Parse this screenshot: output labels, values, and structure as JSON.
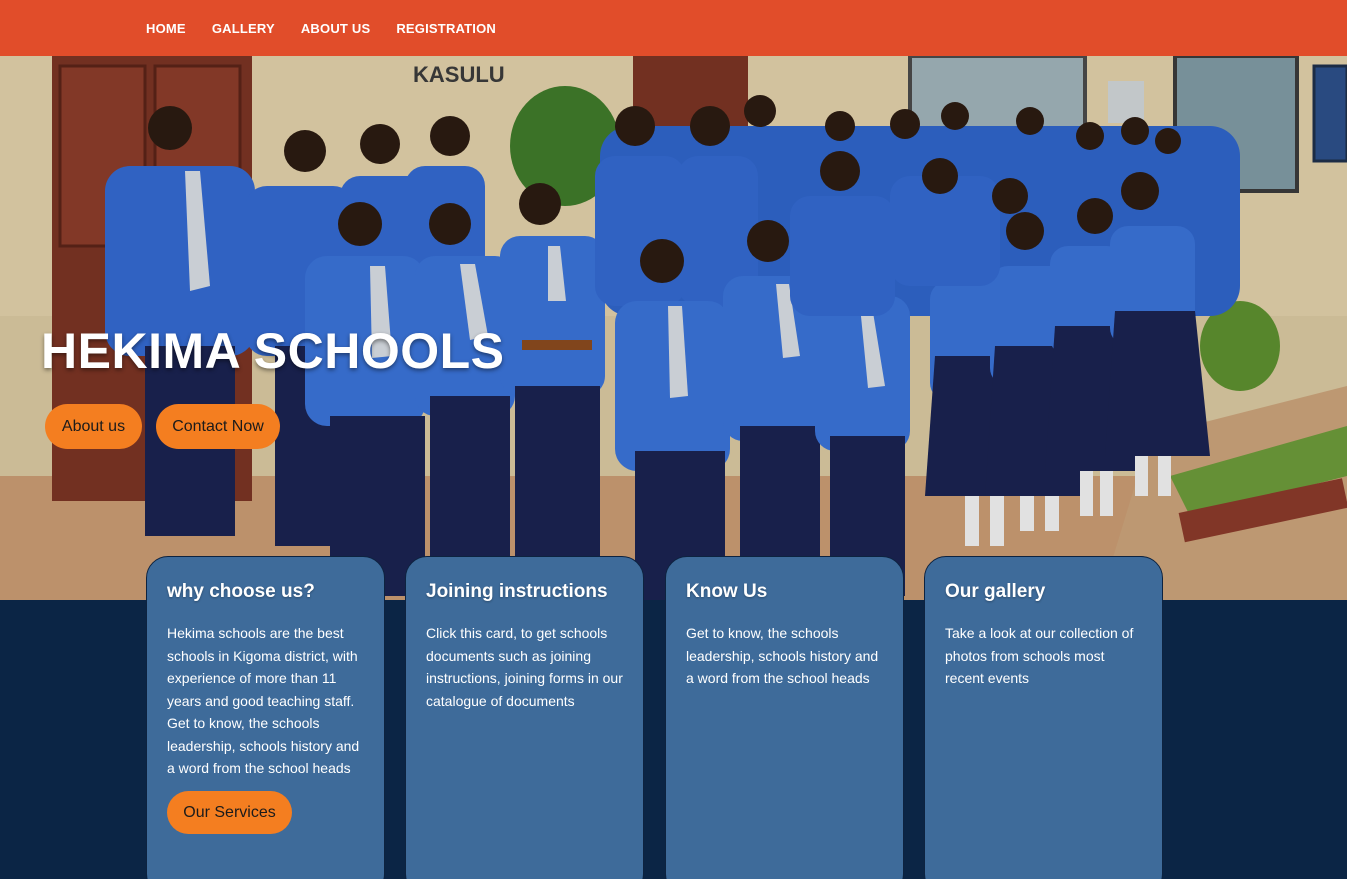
{
  "nav": {
    "items": [
      "HOME",
      "GALLERY",
      "ABOUT US",
      "REGISTRATION"
    ]
  },
  "hero": {
    "title": "HEKIMA SCHOOLS",
    "sign_text": "KASULU",
    "about_button": "About us",
    "contact_button": "Contact Now"
  },
  "cards": [
    {
      "title": "why choose us?",
      "text": "Hekima schools are the best schools in Kigoma district, with experience of more than 11 years and good teaching staff. Get to know, the schools leadership, schools history and a word from the school heads",
      "button": "Our Services"
    },
    {
      "title": "Joining instructions",
      "text": "Click this card, to get schools documents such as joining instructions, joining forms in our catalogue of documents"
    },
    {
      "title": "Know Us",
      "text": "Get to know, the schools leadership, schools history and a word from the school heads"
    },
    {
      "title": "Our gallery",
      "text": "Take a look at our collection of photos from schools most recent events"
    }
  ],
  "colors": {
    "nav_bg": "#e14d2a",
    "accent_button": "#f47e20",
    "card_bg": "#3e6b9a",
    "footer_bg": "#0b2545"
  }
}
